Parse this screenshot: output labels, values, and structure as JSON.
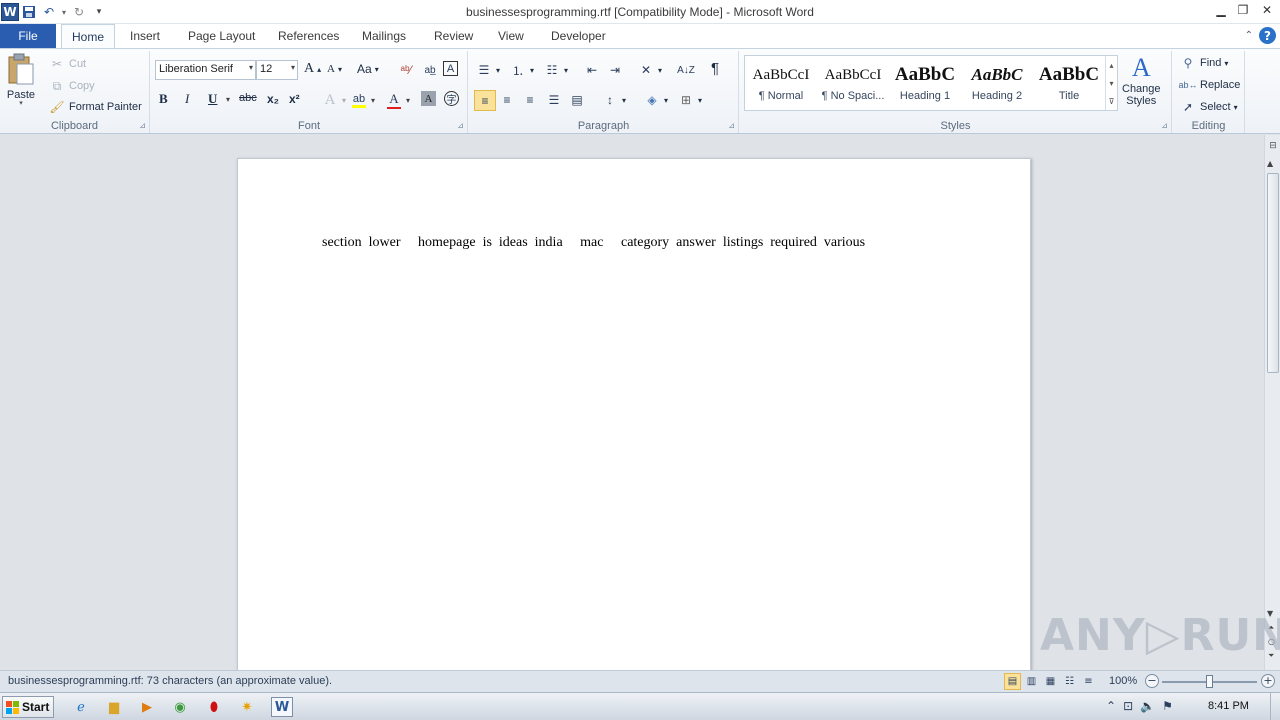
{
  "window": {
    "title": "businessesprogramming.rtf [Compatibility Mode]  -  Microsoft Word",
    "app_logo": "W"
  },
  "tabs": [
    {
      "label": "File"
    },
    {
      "label": "Home"
    },
    {
      "label": "Insert"
    },
    {
      "label": "Page Layout"
    },
    {
      "label": "References"
    },
    {
      "label": "Mailings"
    },
    {
      "label": "Review"
    },
    {
      "label": "View"
    },
    {
      "label": "Developer"
    }
  ],
  "clipboard": {
    "paste": "Paste",
    "cut": "Cut",
    "copy": "Copy",
    "format_painter": "Format Painter",
    "label": "Clipboard"
  },
  "font": {
    "family": "Liberation Serif",
    "size": "12",
    "bold": "B",
    "italic": "I",
    "underline": "U",
    "strike": "abc",
    "subscript": "x₂",
    "superscript": "x²",
    "grow": "A",
    "shrink": "A",
    "change_case": "Aa",
    "label": "Font"
  },
  "paragraph": {
    "label": "Paragraph",
    "show_marks": "¶"
  },
  "styles": {
    "label": "Styles",
    "items": [
      {
        "preview": "AaBbCcI",
        "name": "¶ Normal"
      },
      {
        "preview": "AaBbCcI",
        "name": "¶ No Spaci..."
      },
      {
        "preview": "AaBbC",
        "name": "Heading 1"
      },
      {
        "preview": "AaBbC",
        "name": "Heading 2"
      },
      {
        "preview": "AaBbC",
        "name": "Title"
      }
    ],
    "change_styles_line1": "Change",
    "change_styles_line2": "Styles",
    "change_styles_glyph": "A"
  },
  "editing": {
    "label": "Editing",
    "find": "Find",
    "replace": "Replace",
    "select": "Select"
  },
  "document": {
    "text": "section  lower     homepage  is  ideas  india     mac     category  answer  listings  required  various"
  },
  "statusbar": {
    "text": "businessesprogramming.rtf: 73 characters (an approximate value).",
    "zoom": "100%",
    "zoom_minus": "−",
    "zoom_plus": "+",
    "zoom_level": 1.0
  },
  "taskbar": {
    "start": "Start",
    "clock": "8:41 PM"
  },
  "watermark": "ANY▷RUN",
  "colors": {
    "file_tab": "#2a5db0",
    "word_blue": "#2b5797",
    "highlight": "#fbe29a",
    "font_color_bar": "#e02020",
    "highlight_color_bar": "#ffff00"
  }
}
